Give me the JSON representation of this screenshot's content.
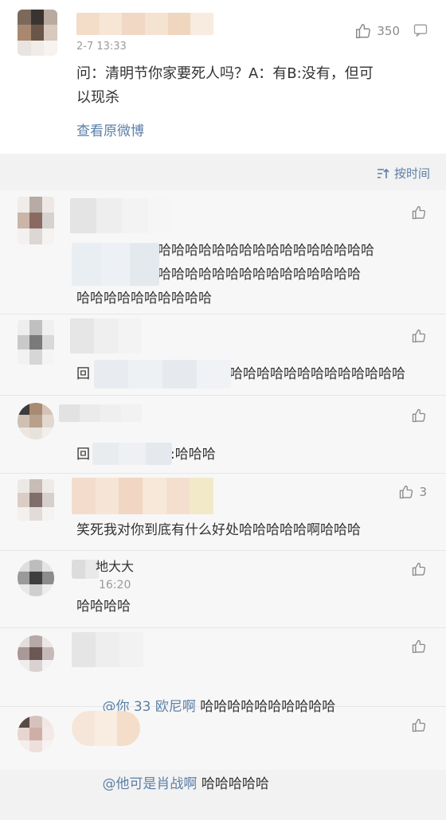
{
  "top_post": {
    "time": "2-7 13:33",
    "like_count": "350",
    "text": "问：清明节你家要死人吗？A：有B:没有，但可\n以现杀",
    "view_original": "查看原微博"
  },
  "sort": {
    "label": "按时间"
  },
  "comments": [
    {
      "text": "哈哈哈哈哈哈哈哈哈哈哈哈哈哈哈哈哈哈哈哈哈哈哈哈哈哈哈哈哈哈哈哈哈哈哈哈哈哈哈哈哈哈哈哈哈哈哈",
      "line1": "哈哈哈哈哈哈哈哈哈哈哈哈哈哈哈哈哈哈哈哈哈哈",
      "line2": "哈哈哈哈哈哈哈哈哈哈哈哈哈哈哈哈哈哈哈哈哈",
      "line3": "哈哈哈哈哈哈哈哈哈哈",
      "like_count": ""
    },
    {
      "prefix": "回",
      "text": "哈哈哈哈哈哈哈哈哈哈哈哈哈",
      "like_count": ""
    },
    {
      "prefix": "回",
      "text": ":哈哈哈",
      "like_count": ""
    },
    {
      "text": "笑死我对你到底有什么好处哈哈哈哈哈啊哈哈哈",
      "like_count": "3"
    },
    {
      "name": "地大大",
      "time": "16:20",
      "text": "哈哈哈哈",
      "like_count": ""
    },
    {
      "mention": "@你 33 欧尼啊",
      "text": " 哈哈哈哈哈哈哈哈哈哈",
      "like_count": ""
    },
    {
      "mention": "@他可是肖战啊",
      "text": " 哈哈哈哈哈",
      "like_count": ""
    }
  ],
  "colors": {
    "link": "#5b7fa8",
    "muted": "#9a9a9a",
    "text": "#333333"
  }
}
